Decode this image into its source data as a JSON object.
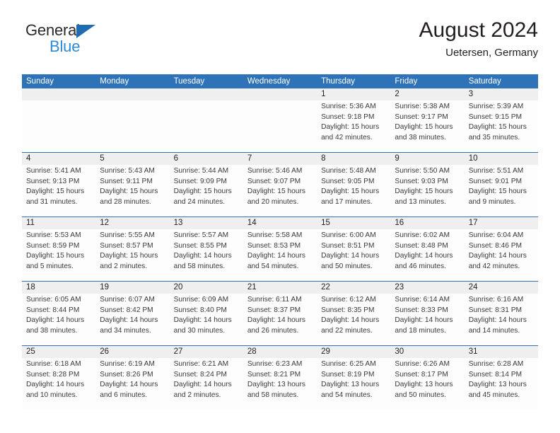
{
  "brand": {
    "name_top": "General",
    "name_bottom": "Blue",
    "triangle_color": "#1f6cb0",
    "bottom_color": "#2e8bd4"
  },
  "header": {
    "title": "August 2024",
    "subtitle": "Uetersen, Germany",
    "accent_color": "#2e73b8"
  },
  "weekday_headers": [
    "Sunday",
    "Monday",
    "Tuesday",
    "Wednesday",
    "Thursday",
    "Friday",
    "Saturday"
  ],
  "weeks": [
    [
      {
        "day": "",
        "lines": []
      },
      {
        "day": "",
        "lines": []
      },
      {
        "day": "",
        "lines": []
      },
      {
        "day": "",
        "lines": []
      },
      {
        "day": "1",
        "lines": [
          "Sunrise: 5:36 AM",
          "Sunset: 9:18 PM",
          "Daylight: 15 hours",
          "and 42 minutes."
        ]
      },
      {
        "day": "2",
        "lines": [
          "Sunrise: 5:38 AM",
          "Sunset: 9:17 PM",
          "Daylight: 15 hours",
          "and 38 minutes."
        ]
      },
      {
        "day": "3",
        "lines": [
          "Sunrise: 5:39 AM",
          "Sunset: 9:15 PM",
          "Daylight: 15 hours",
          "and 35 minutes."
        ]
      }
    ],
    [
      {
        "day": "4",
        "lines": [
          "Sunrise: 5:41 AM",
          "Sunset: 9:13 PM",
          "Daylight: 15 hours",
          "and 31 minutes."
        ]
      },
      {
        "day": "5",
        "lines": [
          "Sunrise: 5:43 AM",
          "Sunset: 9:11 PM",
          "Daylight: 15 hours",
          "and 28 minutes."
        ]
      },
      {
        "day": "6",
        "lines": [
          "Sunrise: 5:44 AM",
          "Sunset: 9:09 PM",
          "Daylight: 15 hours",
          "and 24 minutes."
        ]
      },
      {
        "day": "7",
        "lines": [
          "Sunrise: 5:46 AM",
          "Sunset: 9:07 PM",
          "Daylight: 15 hours",
          "and 20 minutes."
        ]
      },
      {
        "day": "8",
        "lines": [
          "Sunrise: 5:48 AM",
          "Sunset: 9:05 PM",
          "Daylight: 15 hours",
          "and 17 minutes."
        ]
      },
      {
        "day": "9",
        "lines": [
          "Sunrise: 5:50 AM",
          "Sunset: 9:03 PM",
          "Daylight: 15 hours",
          "and 13 minutes."
        ]
      },
      {
        "day": "10",
        "lines": [
          "Sunrise: 5:51 AM",
          "Sunset: 9:01 PM",
          "Daylight: 15 hours",
          "and 9 minutes."
        ]
      }
    ],
    [
      {
        "day": "11",
        "lines": [
          "Sunrise: 5:53 AM",
          "Sunset: 8:59 PM",
          "Daylight: 15 hours",
          "and 5 minutes."
        ]
      },
      {
        "day": "12",
        "lines": [
          "Sunrise: 5:55 AM",
          "Sunset: 8:57 PM",
          "Daylight: 15 hours",
          "and 2 minutes."
        ]
      },
      {
        "day": "13",
        "lines": [
          "Sunrise: 5:57 AM",
          "Sunset: 8:55 PM",
          "Daylight: 14 hours",
          "and 58 minutes."
        ]
      },
      {
        "day": "14",
        "lines": [
          "Sunrise: 5:58 AM",
          "Sunset: 8:53 PM",
          "Daylight: 14 hours",
          "and 54 minutes."
        ]
      },
      {
        "day": "15",
        "lines": [
          "Sunrise: 6:00 AM",
          "Sunset: 8:51 PM",
          "Daylight: 14 hours",
          "and 50 minutes."
        ]
      },
      {
        "day": "16",
        "lines": [
          "Sunrise: 6:02 AM",
          "Sunset: 8:48 PM",
          "Daylight: 14 hours",
          "and 46 minutes."
        ]
      },
      {
        "day": "17",
        "lines": [
          "Sunrise: 6:04 AM",
          "Sunset: 8:46 PM",
          "Daylight: 14 hours",
          "and 42 minutes."
        ]
      }
    ],
    [
      {
        "day": "18",
        "lines": [
          "Sunrise: 6:05 AM",
          "Sunset: 8:44 PM",
          "Daylight: 14 hours",
          "and 38 minutes."
        ]
      },
      {
        "day": "19",
        "lines": [
          "Sunrise: 6:07 AM",
          "Sunset: 8:42 PM",
          "Daylight: 14 hours",
          "and 34 minutes."
        ]
      },
      {
        "day": "20",
        "lines": [
          "Sunrise: 6:09 AM",
          "Sunset: 8:40 PM",
          "Daylight: 14 hours",
          "and 30 minutes."
        ]
      },
      {
        "day": "21",
        "lines": [
          "Sunrise: 6:11 AM",
          "Sunset: 8:37 PM",
          "Daylight: 14 hours",
          "and 26 minutes."
        ]
      },
      {
        "day": "22",
        "lines": [
          "Sunrise: 6:12 AM",
          "Sunset: 8:35 PM",
          "Daylight: 14 hours",
          "and 22 minutes."
        ]
      },
      {
        "day": "23",
        "lines": [
          "Sunrise: 6:14 AM",
          "Sunset: 8:33 PM",
          "Daylight: 14 hours",
          "and 18 minutes."
        ]
      },
      {
        "day": "24",
        "lines": [
          "Sunrise: 6:16 AM",
          "Sunset: 8:31 PM",
          "Daylight: 14 hours",
          "and 14 minutes."
        ]
      }
    ],
    [
      {
        "day": "25",
        "lines": [
          "Sunrise: 6:18 AM",
          "Sunset: 8:28 PM",
          "Daylight: 14 hours",
          "and 10 minutes."
        ]
      },
      {
        "day": "26",
        "lines": [
          "Sunrise: 6:19 AM",
          "Sunset: 8:26 PM",
          "Daylight: 14 hours",
          "and 6 minutes."
        ]
      },
      {
        "day": "27",
        "lines": [
          "Sunrise: 6:21 AM",
          "Sunset: 8:24 PM",
          "Daylight: 14 hours",
          "and 2 minutes."
        ]
      },
      {
        "day": "28",
        "lines": [
          "Sunrise: 6:23 AM",
          "Sunset: 8:21 PM",
          "Daylight: 13 hours",
          "and 58 minutes."
        ]
      },
      {
        "day": "29",
        "lines": [
          "Sunrise: 6:25 AM",
          "Sunset: 8:19 PM",
          "Daylight: 13 hours",
          "and 54 minutes."
        ]
      },
      {
        "day": "30",
        "lines": [
          "Sunrise: 6:26 AM",
          "Sunset: 8:17 PM",
          "Daylight: 13 hours",
          "and 50 minutes."
        ]
      },
      {
        "day": "31",
        "lines": [
          "Sunrise: 6:28 AM",
          "Sunset: 8:14 PM",
          "Daylight: 13 hours",
          "and 45 minutes."
        ]
      }
    ]
  ]
}
